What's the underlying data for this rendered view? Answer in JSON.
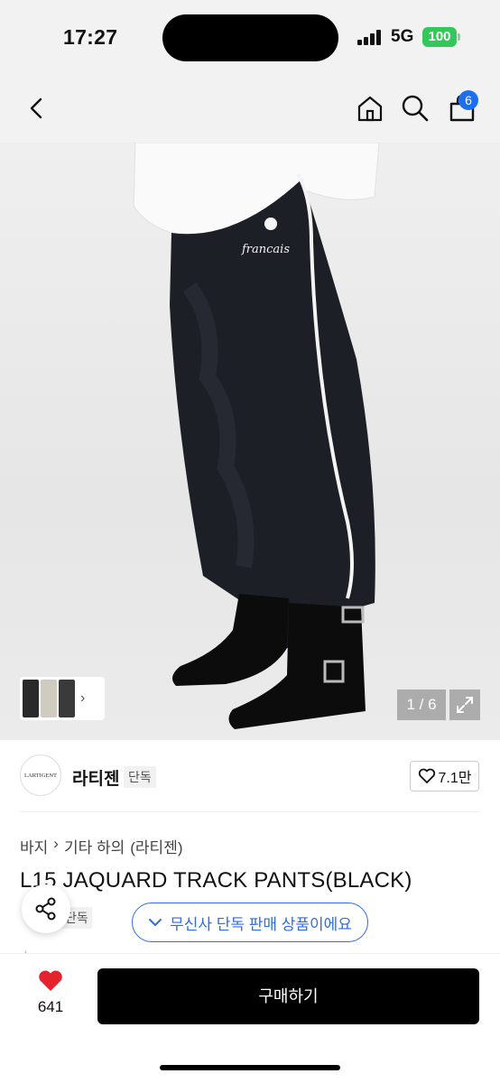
{
  "status_bar": {
    "time": "17:27",
    "network": "5G",
    "battery": "100"
  },
  "header": {
    "cart_count": "6"
  },
  "icons": [
    "back-icon",
    "home-icon",
    "search-icon",
    "cart-icon",
    "expand-icon",
    "heart-icon",
    "share-icon",
    "chevron-right-icon"
  ],
  "gallery": {
    "counter": "1 / 6",
    "logo_text": "francais"
  },
  "brand": {
    "logo_text": "LARTIGENT",
    "name": "라티젠",
    "tag": "단독",
    "likes": "7.1만"
  },
  "breadcrumb": [
    "바지",
    "기타 하의",
    "(라티젠)"
  ],
  "product": {
    "title": "L15 JAQUARD TRACK PANTS(BLACK)",
    "tag": "단독",
    "exclusive_banner": "무신사 단독 판매 상품이에요"
  },
  "bottom": {
    "like_count": "641",
    "buy_label": "구매하기"
  },
  "colors": {
    "accent": "#2f6de1",
    "badge": "#1e6ff0",
    "heart": "#e5232f",
    "battery": "#34c759"
  }
}
